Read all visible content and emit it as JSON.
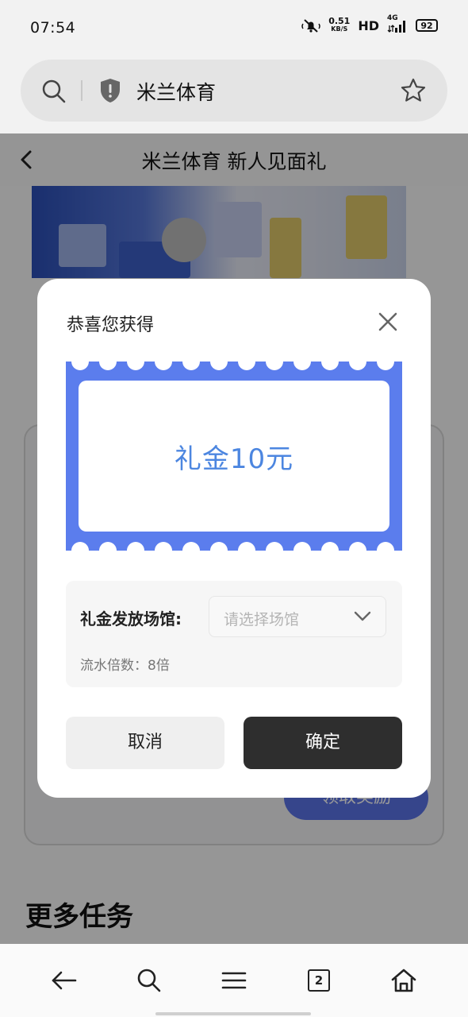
{
  "status_bar": {
    "time": "07:54",
    "speed_value": "0.51",
    "speed_unit": "KB/S",
    "hd": "HD",
    "network": "4G",
    "battery": "92"
  },
  "address_bar": {
    "url_text": "米兰体育"
  },
  "page": {
    "title": "米兰体育 新人见面礼",
    "claim_button": "领取奖励",
    "more_tasks": "更多任务"
  },
  "dialog": {
    "title": "恭喜您获得",
    "coupon_text": "礼金10元",
    "venue_label": "礼金发放场馆:",
    "venue_placeholder": "请选择场馆",
    "rollover": "流水倍数：8倍",
    "cancel": "取消",
    "confirm": "确定"
  },
  "bottom_nav": {
    "tab_count": "2"
  },
  "colors": {
    "coupon_blue": "#5b7ded",
    "coupon_text": "#4c86e0",
    "confirm_bg": "#2e2e2e"
  }
}
